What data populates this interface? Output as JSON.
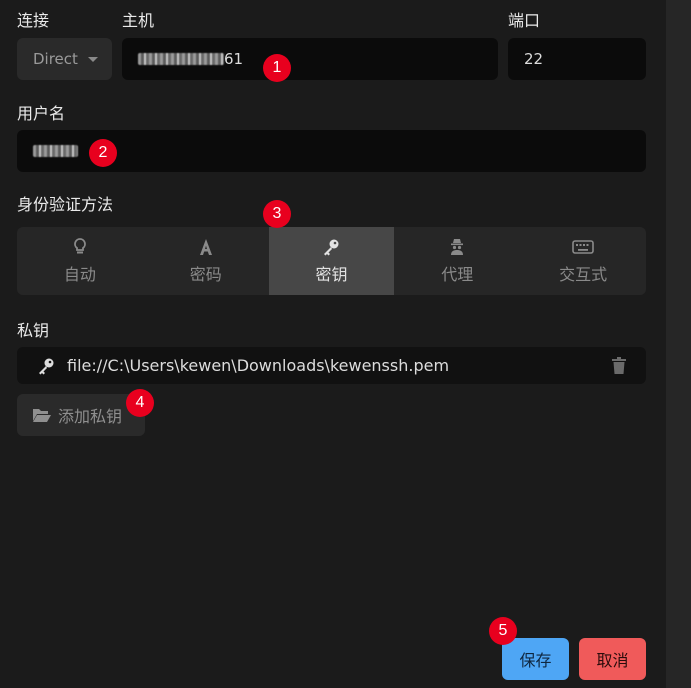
{
  "labels": {
    "connection": "连接",
    "host": "主机",
    "port": "端口",
    "username": "用户名",
    "auth_method": "身份验证方法",
    "private_key": "私钥"
  },
  "connection": {
    "selected": "Direct"
  },
  "host": {
    "value_suffix": "61"
  },
  "port": {
    "value": "22"
  },
  "auth": {
    "tabs": [
      {
        "label": "自动",
        "icon": "lightbulb-icon"
      },
      {
        "label": "密码",
        "icon": "font-icon"
      },
      {
        "label": "密钥",
        "icon": "key-icon",
        "active": true
      },
      {
        "label": "代理",
        "icon": "agent-icon"
      },
      {
        "label": "交互式",
        "icon": "keyboard-icon"
      }
    ]
  },
  "private_key": {
    "path": "file://C:\\Users\\kewen\\Downloads\\kewenssh.pem"
  },
  "add_key": {
    "label": "添加私钥"
  },
  "actions": {
    "save": "保存",
    "cancel": "取消"
  },
  "badges": [
    "1",
    "2",
    "3",
    "4",
    "5"
  ],
  "colors": {
    "background": "#1b1b1b",
    "field": "#0b0b0b",
    "active_tab": "#474747",
    "save": "#4ea6f5",
    "cancel": "#f05a5a",
    "badge": "#e8001e"
  }
}
